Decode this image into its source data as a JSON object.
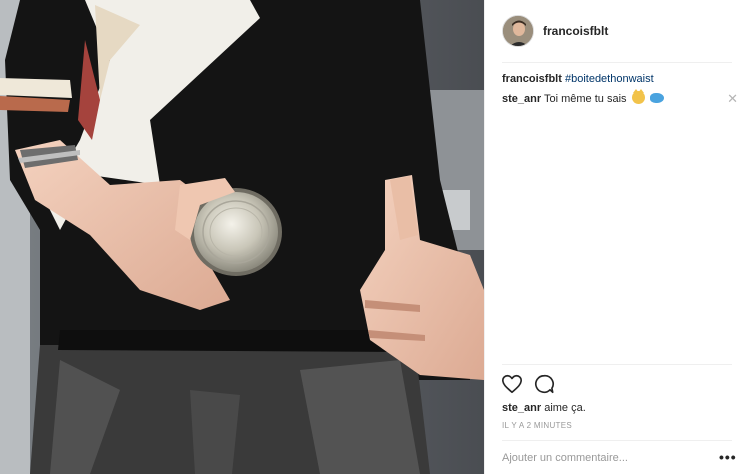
{
  "post": {
    "photo_icon": "post-photo",
    "author": "francoisfblt"
  },
  "caption": {
    "user": "francoisfblt",
    "hashtag": "#boitedethonwaist"
  },
  "comments": [
    {
      "user": "ste_anr",
      "text": "Toi même tu sais",
      "emojis": [
        "cat-smile-emoji",
        "fish-emoji"
      ]
    }
  ],
  "likes": {
    "user": "ste_anr",
    "suffix": " aime ça."
  },
  "timestamp": "IL Y A 2 MINUTES",
  "add_comment": {
    "placeholder": "Ajouter un commentaire..."
  },
  "more_label": "•••",
  "close_label": "✕",
  "colors": {
    "link": "#003569",
    "muted": "#999999",
    "text": "#262626"
  }
}
